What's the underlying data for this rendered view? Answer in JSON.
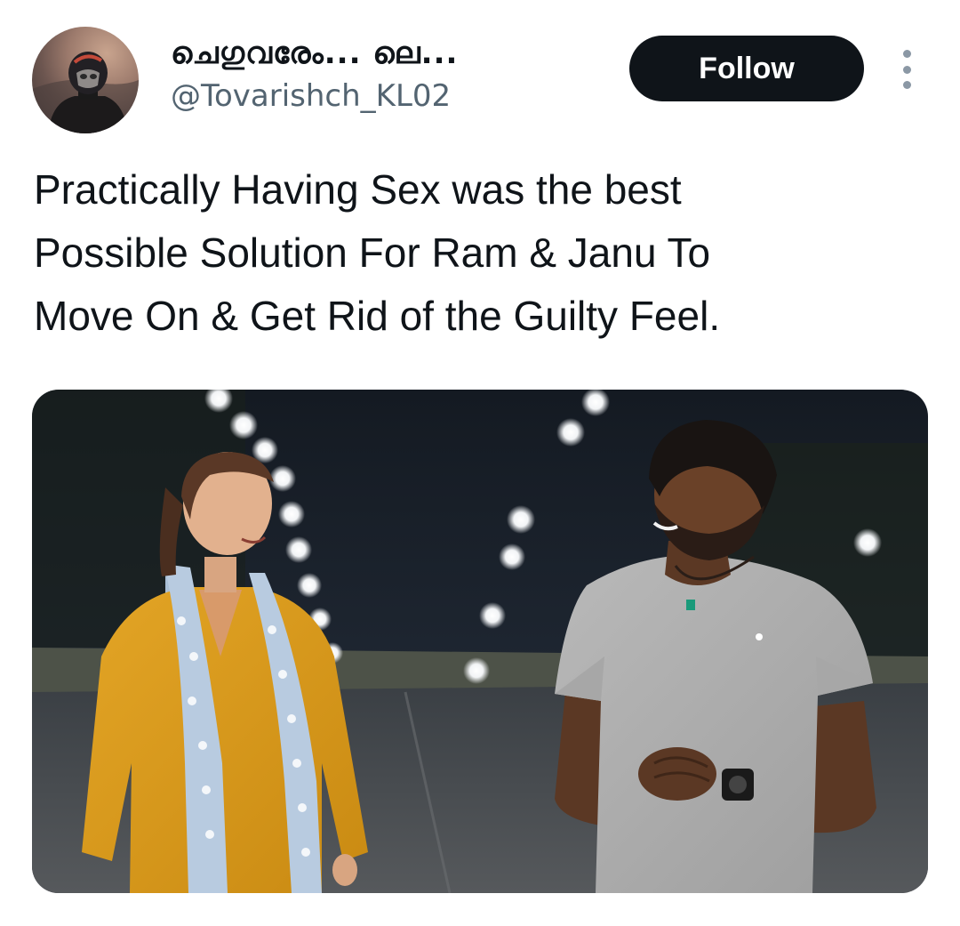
{
  "author": {
    "display_name": "ചെഗുവരേം... ലെ...",
    "handle": "@Tovarishch_KL02",
    "avatar_icon": "helmet-rider-avatar"
  },
  "actions": {
    "follow_label": "Follow",
    "more_icon": "more-vertical-icon"
  },
  "tweet": {
    "text_lines": [
      "Practically Having Sex was the best",
      "Possible Solution For Ram & Janu To",
      "Move On & Get Rid of the Guilty Feel."
    ]
  },
  "media": {
    "type": "photo",
    "icon": "photo-night-street-scene"
  },
  "colors": {
    "text": "#0f1419",
    "secondary_text": "#536471",
    "follow_bg": "#0f1419",
    "follow_text": "#ffffff"
  }
}
